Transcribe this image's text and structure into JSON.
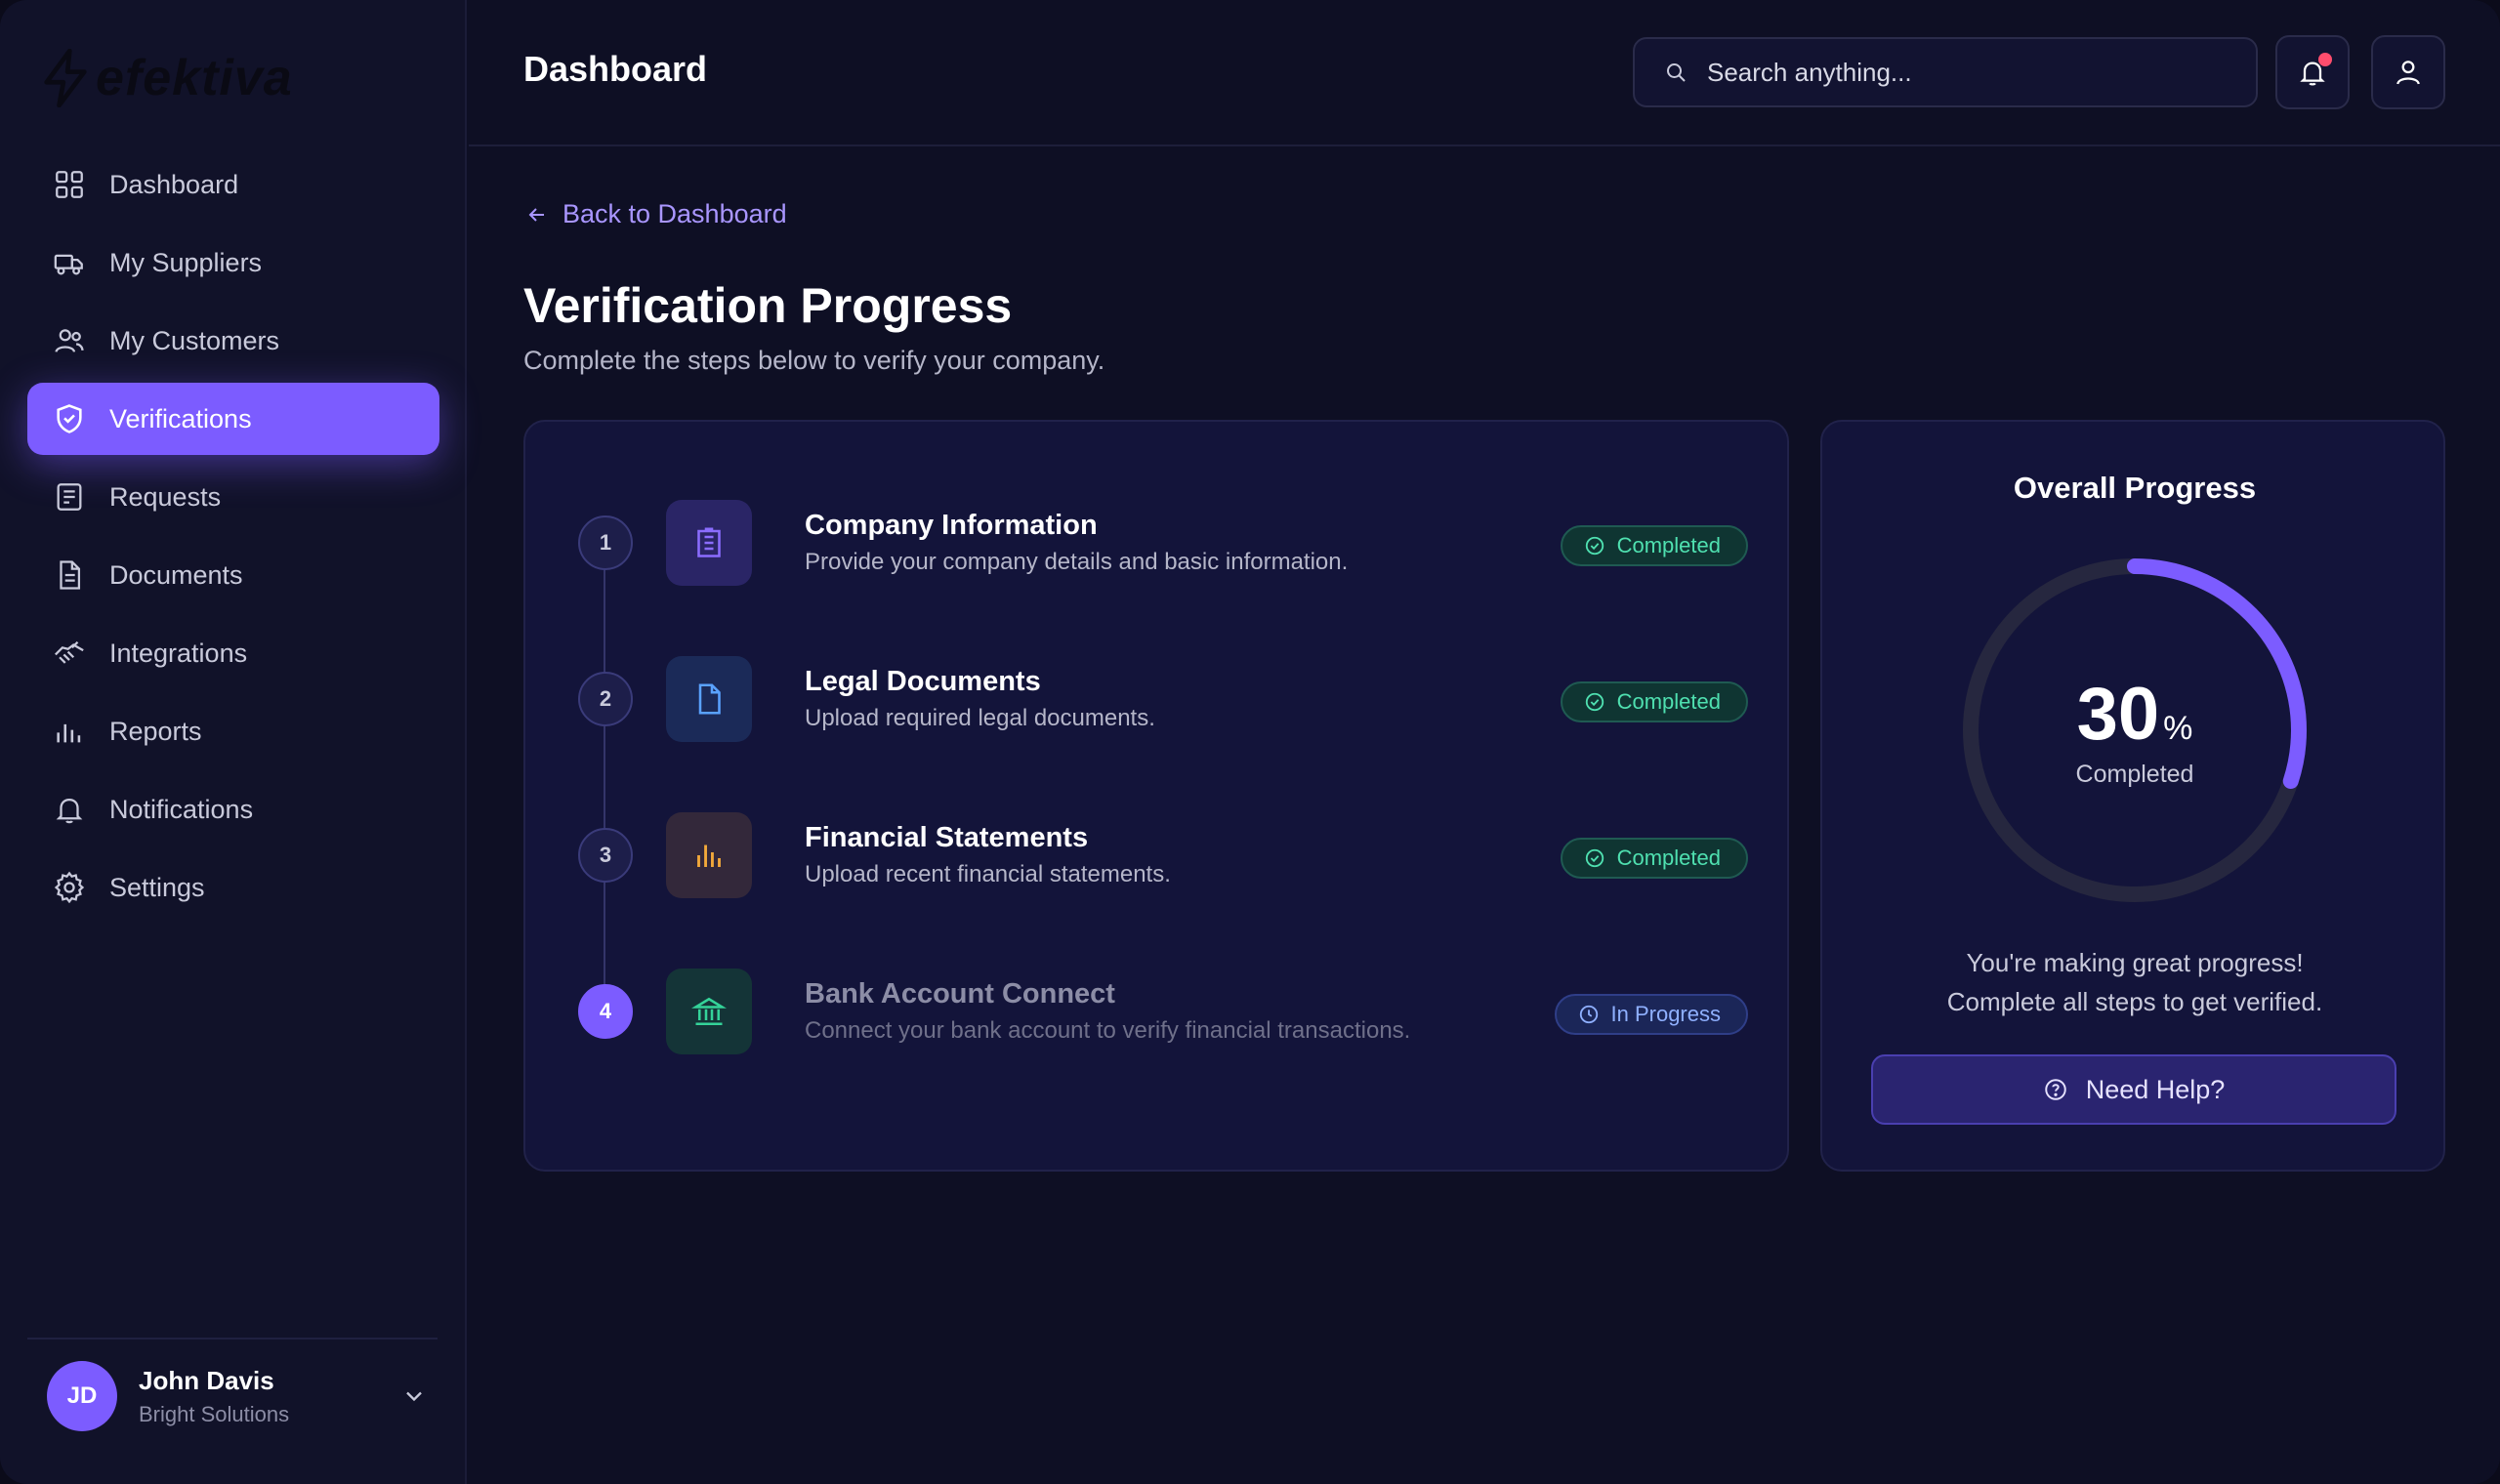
{
  "brand": {
    "name": "efektiva",
    "accent": "#7c5cff"
  },
  "sidebar": {
    "items": [
      {
        "label": "Dashboard",
        "icon": "grid-icon",
        "active": false
      },
      {
        "label": "My Suppliers",
        "icon": "truck-icon",
        "active": false
      },
      {
        "label": "My Customers",
        "icon": "users-icon",
        "active": false
      },
      {
        "label": "Verifications",
        "icon": "shield-check-icon",
        "active": true
      },
      {
        "label": "Requests",
        "icon": "inbox-icon",
        "active": false
      },
      {
        "label": "Documents",
        "icon": "document-icon",
        "active": false
      },
      {
        "label": "Integrations",
        "icon": "handshake-icon",
        "active": false
      },
      {
        "label": "Reports",
        "icon": "bar-chart-icon",
        "active": false
      },
      {
        "label": "Notifications",
        "icon": "bell-icon",
        "active": false
      },
      {
        "label": "Settings",
        "icon": "gear-icon",
        "active": false
      }
    ],
    "user": {
      "initials": "JD",
      "name": "John Davis",
      "company": "Bright Solutions"
    }
  },
  "header": {
    "title": "Dashboard",
    "search_placeholder": "Search anything...",
    "has_unread_notifications": true
  },
  "main": {
    "back_label": "Back to Dashboard",
    "title": "Verification Progress",
    "subtitle": "Complete the steps below to verify your company.",
    "steps": [
      {
        "number": "1",
        "title": "Company Information",
        "description": "Provide your company details and basic information.",
        "status": "Completed",
        "icon": "building-icon",
        "icon_color": "#7c5cff"
      },
      {
        "number": "2",
        "title": "Legal Documents",
        "description": "Upload required legal documents.",
        "status": "Completed",
        "icon": "file-icon",
        "icon_color": "#5aa2ff"
      },
      {
        "number": "3",
        "title": "Financial Statements",
        "description": "Upload recent financial statements.",
        "status": "Completed",
        "icon": "bar-chart-icon",
        "icon_color": "#f2a93b"
      },
      {
        "number": "4",
        "title": "Bank Account Connect",
        "description": "Connect your bank account to verify financial transactions.",
        "status": "In Progress",
        "icon": "bank-icon",
        "icon_color": "#34d399"
      }
    ]
  },
  "overall": {
    "title": "Overall Progress",
    "percent": 30,
    "percent_text": "30",
    "percent_sign": "%",
    "percent_label": "Completed",
    "message_line1": "You're making great progress!",
    "message_line2": "Complete all steps to get verified.",
    "help_label": "Need Help?"
  }
}
